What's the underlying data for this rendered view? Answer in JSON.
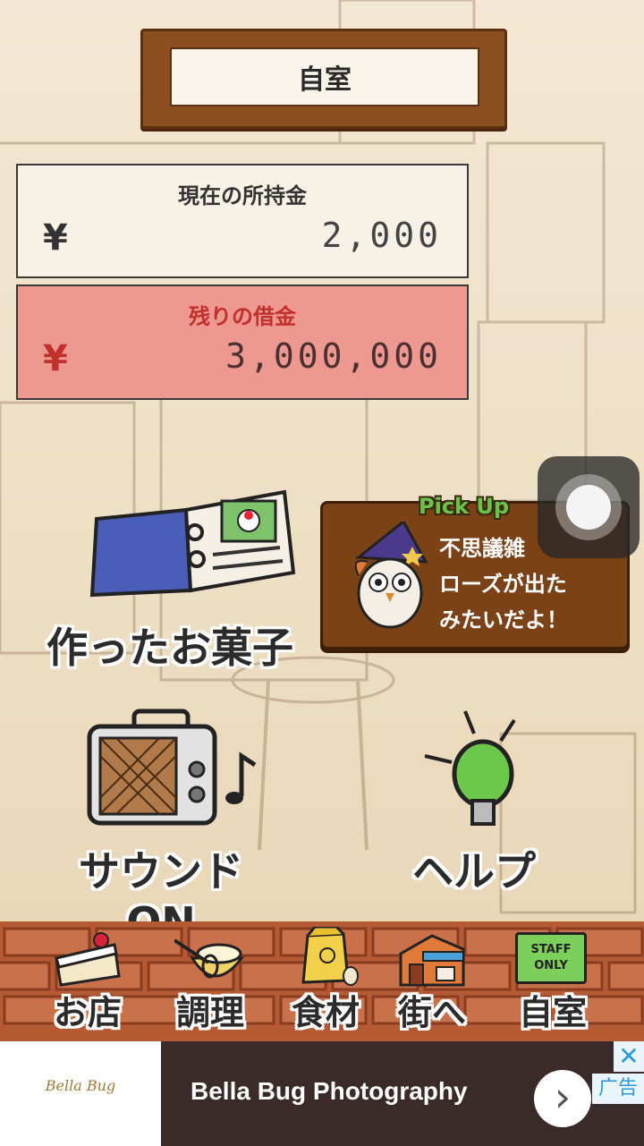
{
  "location_title": "自室",
  "cash": {
    "label": "現在の所持金",
    "currency": "¥",
    "amount": "2,000"
  },
  "debt": {
    "label": "残りの借金",
    "currency": "¥",
    "amount": "3,000,000"
  },
  "menu": {
    "made_sweets": "作ったお菓子",
    "sound": "サウンドON",
    "help": "ヘルプ"
  },
  "pickup": {
    "tag": "Pick Up",
    "line1": "不思議雑",
    "line2": "ローズが出た",
    "line3": "みたいだよ！"
  },
  "nav": {
    "shop": "お店",
    "cooking": "調理",
    "ingredients": "食材",
    "to_town": "街へ",
    "room": "自室",
    "staff_only": "STAFF ONLY"
  },
  "ad": {
    "logo_text": "Bella Bug",
    "title": "Bella Bug Photography",
    "badge": "广告",
    "close": "✕",
    "arrow": "›"
  },
  "colors": {
    "debt_red": "#c0312b",
    "debt_panel": "#ef9891",
    "wood": "#7a4216",
    "brick": "#b65a34"
  }
}
